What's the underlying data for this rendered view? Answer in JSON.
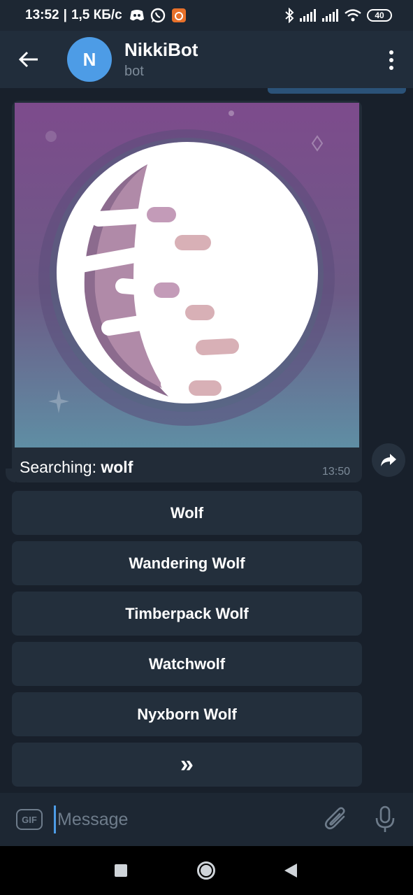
{
  "status_bar": {
    "time": "13:52",
    "separator": "|",
    "speed": "1,5 КБ/с",
    "battery": "40"
  },
  "header": {
    "avatar_letter": "N",
    "title": "NikkiBot",
    "subtitle": "bot"
  },
  "message": {
    "text_prefix": "Searching: ",
    "query": "wolf",
    "time": "13:50"
  },
  "keyboard": {
    "buttons": [
      "Wolf",
      "Wandering Wolf",
      "Timberpack Wolf",
      "Watchwolf",
      "Nyxborn Wolf",
      "»"
    ]
  },
  "composer": {
    "placeholder": "Message",
    "gif_label": "GIF"
  },
  "colors": {
    "accent": "#4d9ce6",
    "background": "#18202b",
    "header": "#212d3b",
    "bubble": "#222c38",
    "button": "#232f3c"
  }
}
